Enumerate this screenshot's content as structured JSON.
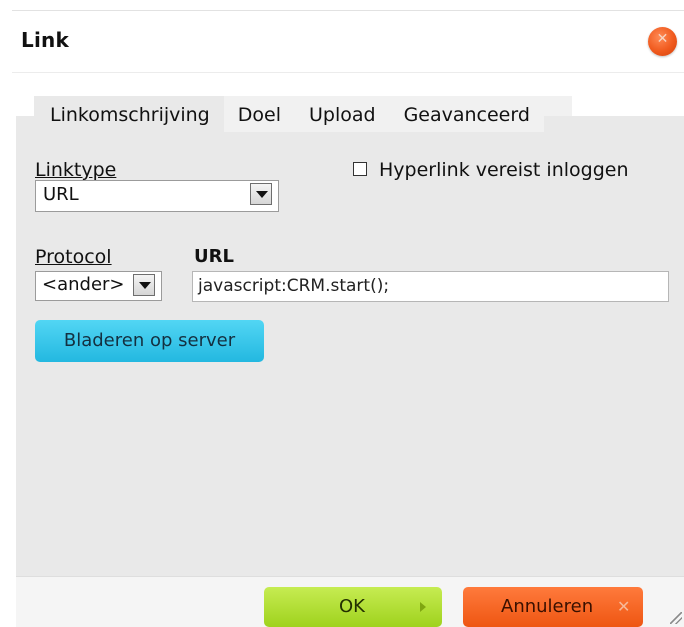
{
  "dialog": {
    "title": "Link",
    "close_icon": "close-icon"
  },
  "tabs": [
    {
      "label": "Linkomschrijving",
      "active": true
    },
    {
      "label": "Doel",
      "active": false
    },
    {
      "label": "Upload",
      "active": false
    },
    {
      "label": "Geavanceerd",
      "active": false
    }
  ],
  "form": {
    "linktype_label": "Linktype",
    "linktype_value": "URL",
    "login_checkbox_label": "Hyperlink vereist inloggen",
    "login_checkbox_checked": false,
    "protocol_label": "Protocol",
    "protocol_value": "<ander>",
    "url_label": "URL",
    "url_value": "javascript:CRM.start();",
    "browse_label": "Bladeren op server"
  },
  "footer": {
    "ok_label": "OK",
    "cancel_label": "Annuleren"
  },
  "colors": {
    "ok_button": "#a8d82a",
    "cancel_button": "#f26120",
    "browse_button": "#35c3e8",
    "close_button": "#f05a1e",
    "panel_bg": "#e9e9e9"
  }
}
